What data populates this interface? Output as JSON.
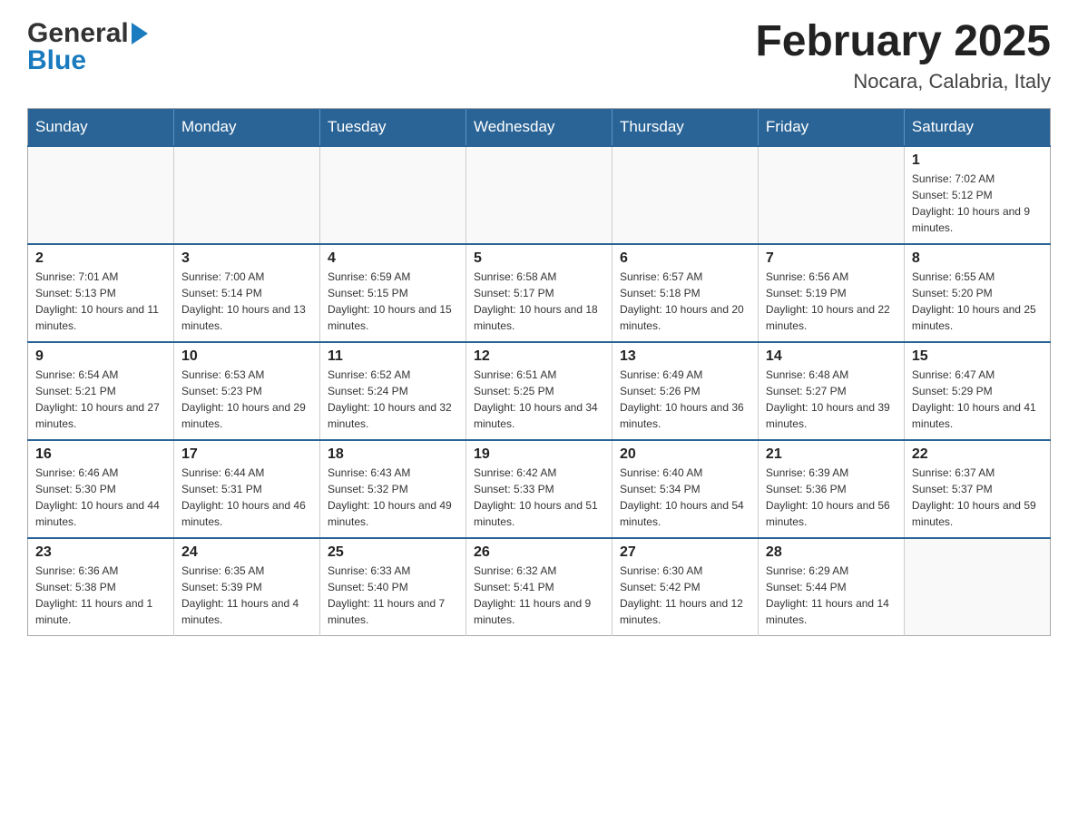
{
  "logo": {
    "general": "General",
    "blue": "Blue",
    "arrow_shape": "triangle-right"
  },
  "title": {
    "month_year": "February 2025",
    "location": "Nocara, Calabria, Italy"
  },
  "weekdays": [
    "Sunday",
    "Monday",
    "Tuesday",
    "Wednesday",
    "Thursday",
    "Friday",
    "Saturday"
  ],
  "weeks": [
    {
      "days": [
        {
          "number": "",
          "info": ""
        },
        {
          "number": "",
          "info": ""
        },
        {
          "number": "",
          "info": ""
        },
        {
          "number": "",
          "info": ""
        },
        {
          "number": "",
          "info": ""
        },
        {
          "number": "",
          "info": ""
        },
        {
          "number": "1",
          "info": "Sunrise: 7:02 AM\nSunset: 5:12 PM\nDaylight: 10 hours and 9 minutes."
        }
      ]
    },
    {
      "days": [
        {
          "number": "2",
          "info": "Sunrise: 7:01 AM\nSunset: 5:13 PM\nDaylight: 10 hours and 11 minutes."
        },
        {
          "number": "3",
          "info": "Sunrise: 7:00 AM\nSunset: 5:14 PM\nDaylight: 10 hours and 13 minutes."
        },
        {
          "number": "4",
          "info": "Sunrise: 6:59 AM\nSunset: 5:15 PM\nDaylight: 10 hours and 15 minutes."
        },
        {
          "number": "5",
          "info": "Sunrise: 6:58 AM\nSunset: 5:17 PM\nDaylight: 10 hours and 18 minutes."
        },
        {
          "number": "6",
          "info": "Sunrise: 6:57 AM\nSunset: 5:18 PM\nDaylight: 10 hours and 20 minutes."
        },
        {
          "number": "7",
          "info": "Sunrise: 6:56 AM\nSunset: 5:19 PM\nDaylight: 10 hours and 22 minutes."
        },
        {
          "number": "8",
          "info": "Sunrise: 6:55 AM\nSunset: 5:20 PM\nDaylight: 10 hours and 25 minutes."
        }
      ]
    },
    {
      "days": [
        {
          "number": "9",
          "info": "Sunrise: 6:54 AM\nSunset: 5:21 PM\nDaylight: 10 hours and 27 minutes."
        },
        {
          "number": "10",
          "info": "Sunrise: 6:53 AM\nSunset: 5:23 PM\nDaylight: 10 hours and 29 minutes."
        },
        {
          "number": "11",
          "info": "Sunrise: 6:52 AM\nSunset: 5:24 PM\nDaylight: 10 hours and 32 minutes."
        },
        {
          "number": "12",
          "info": "Sunrise: 6:51 AM\nSunset: 5:25 PM\nDaylight: 10 hours and 34 minutes."
        },
        {
          "number": "13",
          "info": "Sunrise: 6:49 AM\nSunset: 5:26 PM\nDaylight: 10 hours and 36 minutes."
        },
        {
          "number": "14",
          "info": "Sunrise: 6:48 AM\nSunset: 5:27 PM\nDaylight: 10 hours and 39 minutes."
        },
        {
          "number": "15",
          "info": "Sunrise: 6:47 AM\nSunset: 5:29 PM\nDaylight: 10 hours and 41 minutes."
        }
      ]
    },
    {
      "days": [
        {
          "number": "16",
          "info": "Sunrise: 6:46 AM\nSunset: 5:30 PM\nDaylight: 10 hours and 44 minutes."
        },
        {
          "number": "17",
          "info": "Sunrise: 6:44 AM\nSunset: 5:31 PM\nDaylight: 10 hours and 46 minutes."
        },
        {
          "number": "18",
          "info": "Sunrise: 6:43 AM\nSunset: 5:32 PM\nDaylight: 10 hours and 49 minutes."
        },
        {
          "number": "19",
          "info": "Sunrise: 6:42 AM\nSunset: 5:33 PM\nDaylight: 10 hours and 51 minutes."
        },
        {
          "number": "20",
          "info": "Sunrise: 6:40 AM\nSunset: 5:34 PM\nDaylight: 10 hours and 54 minutes."
        },
        {
          "number": "21",
          "info": "Sunrise: 6:39 AM\nSunset: 5:36 PM\nDaylight: 10 hours and 56 minutes."
        },
        {
          "number": "22",
          "info": "Sunrise: 6:37 AM\nSunset: 5:37 PM\nDaylight: 10 hours and 59 minutes."
        }
      ]
    },
    {
      "days": [
        {
          "number": "23",
          "info": "Sunrise: 6:36 AM\nSunset: 5:38 PM\nDaylight: 11 hours and 1 minute."
        },
        {
          "number": "24",
          "info": "Sunrise: 6:35 AM\nSunset: 5:39 PM\nDaylight: 11 hours and 4 minutes."
        },
        {
          "number": "25",
          "info": "Sunrise: 6:33 AM\nSunset: 5:40 PM\nDaylight: 11 hours and 7 minutes."
        },
        {
          "number": "26",
          "info": "Sunrise: 6:32 AM\nSunset: 5:41 PM\nDaylight: 11 hours and 9 minutes."
        },
        {
          "number": "27",
          "info": "Sunrise: 6:30 AM\nSunset: 5:42 PM\nDaylight: 11 hours and 12 minutes."
        },
        {
          "number": "28",
          "info": "Sunrise: 6:29 AM\nSunset: 5:44 PM\nDaylight: 11 hours and 14 minutes."
        },
        {
          "number": "",
          "info": ""
        }
      ]
    }
  ]
}
